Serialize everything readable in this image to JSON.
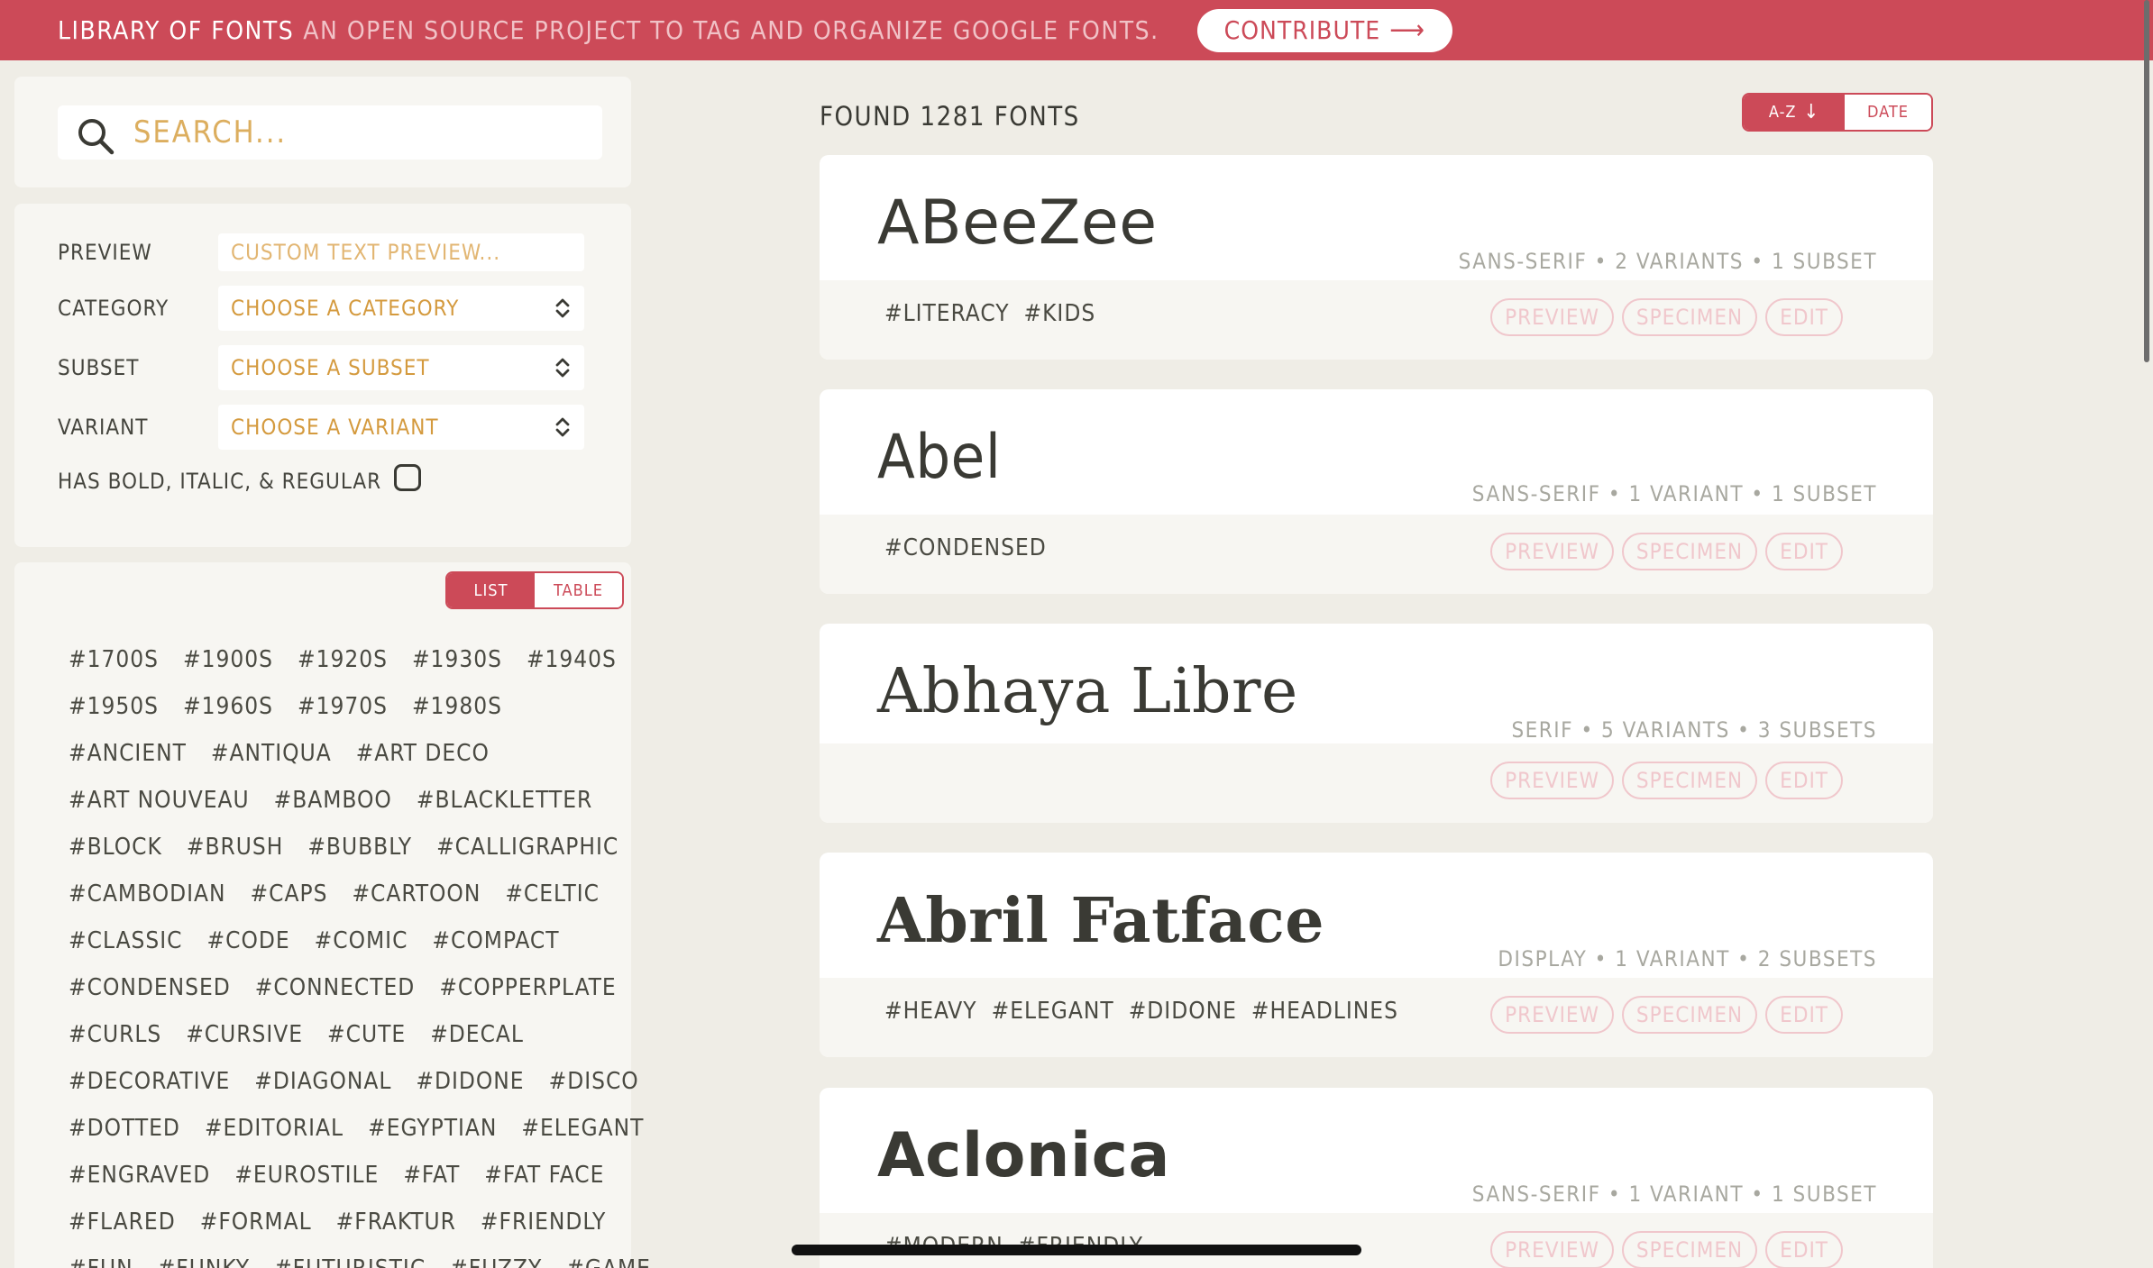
{
  "topbar": {
    "brand": "LIBRARY OF FONTS",
    "tagline": "AN OPEN SOURCE PROJECT TO TAG AND ORGANIZE GOOGLE FONTS.",
    "contribute_label": "CONTRIBUTE",
    "contribute_icon": "arrow-right-icon"
  },
  "search": {
    "placeholder": "SEARCH...",
    "value": ""
  },
  "filters": {
    "preview": {
      "label": "PREVIEW",
      "placeholder": "CUSTOM TEXT PREVIEW..."
    },
    "category": {
      "label": "CATEGORY",
      "selected": "CHOOSE A CATEGORY"
    },
    "subset": {
      "label": "SUBSET",
      "selected": "CHOOSE A SUBSET"
    },
    "variant": {
      "label": "VARIANT",
      "selected": "CHOOSE A VARIANT"
    },
    "has_bold": {
      "label": "HAS BOLD, ITALIC, & REGULAR",
      "checked": false
    }
  },
  "view_toggle": {
    "list": "LIST",
    "table": "TABLE",
    "active": "list"
  },
  "tag_rows": [
    [
      "#1700S",
      "#1900S",
      "#1920S",
      "#1930S",
      "#1940S"
    ],
    [
      "#1950S",
      "#1960S",
      "#1970S",
      "#1980S"
    ],
    [
      "#ANCIENT",
      "#ANTIQUA",
      "#ART DECO"
    ],
    [
      "#ART NOUVEAU",
      "#BAMBOO",
      "#BLACKLETTER"
    ],
    [
      "#BLOCK",
      "#BRUSH",
      "#BUBBLY",
      "#CALLIGRAPHIC"
    ],
    [
      "#CAMBODIAN",
      "#CAPS",
      "#CARTOON",
      "#CELTIC"
    ],
    [
      "#CLASSIC",
      "#CODE",
      "#COMIC",
      "#COMPACT"
    ],
    [
      "#CONDENSED",
      "#CONNECTED",
      "#COPPERPLATE"
    ],
    [
      "#CURLS",
      "#CURSIVE",
      "#CUTE",
      "#DECAL"
    ],
    [
      "#DECORATIVE",
      "#DIAGONAL",
      "#DIDONE",
      "#DISCO"
    ],
    [
      "#DOTTED",
      "#EDITORIAL",
      "#EGYPTIAN",
      "#ELEGANT"
    ],
    [
      "#ENGRAVED",
      "#EUROSTILE",
      "#FAT",
      "#FAT FACE"
    ],
    [
      "#FLARED",
      "#FORMAL",
      "#FRAKTUR",
      "#FRIENDLY"
    ],
    [
      "#FUN",
      "#FUNKY",
      "#FUTURISTIC",
      "#FUZZY",
      "#GAME"
    ]
  ],
  "results": {
    "found_text": "FOUND 1281 FONTS",
    "sort": {
      "az": "A-Z",
      "az_icon": "arrow-down-icon",
      "date": "DATE",
      "active": "az"
    }
  },
  "fonts": [
    {
      "name": "ABeeZee",
      "meta": "SANS-SERIF • 2 VARIANTS • 1 SUBSET",
      "tags": [
        "#LITERACY",
        "#KIDS"
      ]
    },
    {
      "name": "Abel",
      "meta": "SANS-SERIF • 1 VARIANT • 1 SUBSET",
      "tags": [
        "#CONDENSED"
      ]
    },
    {
      "name": "Abhaya Libre",
      "meta": "SERIF • 5 VARIANTS • 3 SUBSETS",
      "tags": []
    },
    {
      "name": "Abril Fatface",
      "meta": "DISPLAY • 1 VARIANT • 2 SUBSETS",
      "tags": [
        "#HEAVY",
        "#ELEGANT",
        "#DIDONE",
        "#HEADLINES"
      ]
    },
    {
      "name": "Aclonica",
      "meta": "SANS-SERIF • 1 VARIANT • 1 SUBSET",
      "tags": [
        "#MODERN",
        "#FRIENDLY"
      ]
    }
  ],
  "card_actions": {
    "preview": "PREVIEW",
    "specimen": "SPECIMEN",
    "edit": "EDIT"
  },
  "colors": {
    "accent": "#cc4a58",
    "background": "#efede6",
    "panel": "#f7f6f2",
    "placeholder": "#d9a24d"
  }
}
